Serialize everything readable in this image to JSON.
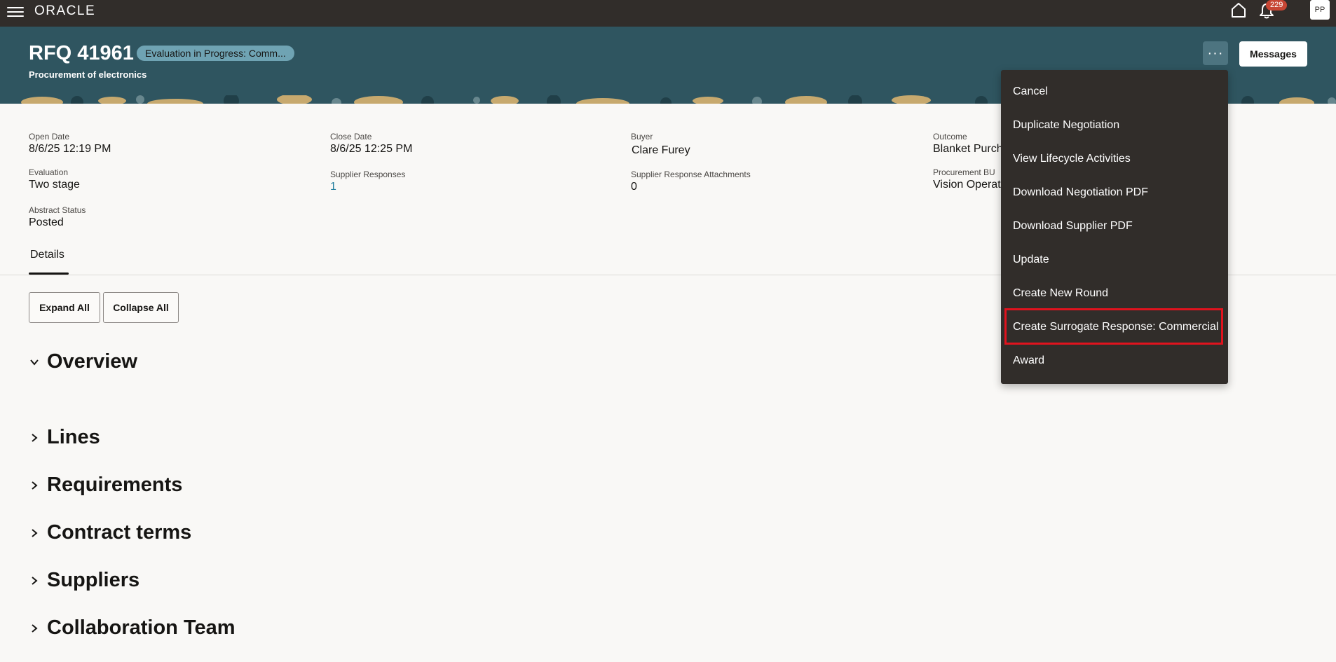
{
  "topbar": {
    "logo": "ORACLE",
    "notifications_count": "229",
    "avatar_initials": "PP"
  },
  "header": {
    "title": "RFQ 41961",
    "status": "Evaluation in Progress: Comm...",
    "subtitle": "Procurement of electronics",
    "more_label": "···",
    "messages_label": "Messages"
  },
  "fields": {
    "open_date": {
      "label": "Open Date",
      "value": "8/6/25 12:19 PM"
    },
    "close_date": {
      "label": "Close Date",
      "value": "8/6/25 12:25 PM"
    },
    "buyer": {
      "label": "Buyer",
      "value": "Clare Furey"
    },
    "outcome": {
      "label": "Outcome",
      "value": "Blanket Purch"
    },
    "evaluation": {
      "label": "Evaluation",
      "value": "Two stage"
    },
    "supplier_responses": {
      "label": "Supplier Responses",
      "value": "1"
    },
    "supplier_response_attachments": {
      "label": "Supplier Response Attachments",
      "value": "0"
    },
    "procurement_bu": {
      "label": "Procurement BU",
      "value": "Vision Operat"
    },
    "abstract_status": {
      "label": "Abstract Status",
      "value": "Posted"
    }
  },
  "tabs": {
    "details": "Details"
  },
  "actions": {
    "expand_all": "Expand All",
    "collapse_all": "Collapse All"
  },
  "sections": {
    "overview": "Overview",
    "lines": "Lines",
    "requirements": "Requirements",
    "contract_terms": "Contract terms",
    "suppliers": "Suppliers",
    "collaboration_team": "Collaboration Team"
  },
  "menu": {
    "items": [
      "Cancel",
      "Duplicate Negotiation",
      "View Lifecycle Activities",
      "Download Negotiation PDF",
      "Download Supplier PDF",
      "Update",
      "Create New Round",
      "Create Surrogate Response: Commercial",
      "Award"
    ]
  },
  "colors": {
    "topbar": "#312d2a",
    "header": "#2f5560",
    "highlight": "#e0131e",
    "link": "#227e9e"
  }
}
